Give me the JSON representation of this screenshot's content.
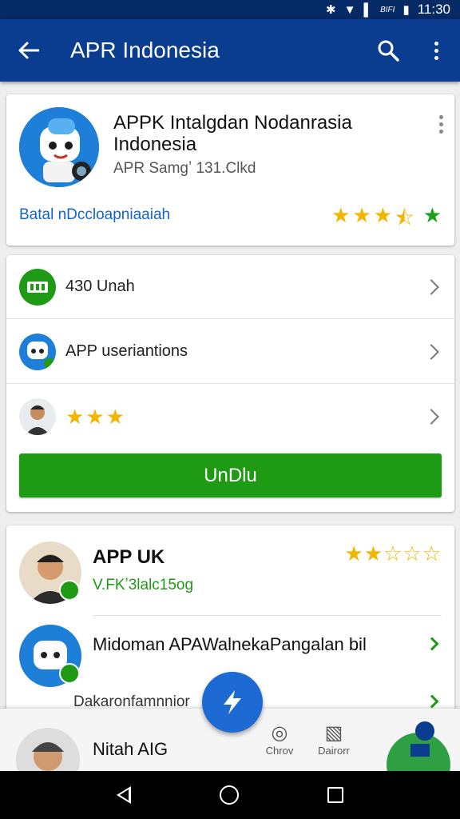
{
  "status_bar": {
    "time": "11:30",
    "carrier": "BIFI"
  },
  "app_bar": {
    "title": "APR Indonesia"
  },
  "app_info": {
    "name": "APPK Intalgdan Nodanrasia Indonesia",
    "meta": "APR Samgʼ 131.Clkd",
    "developer": "Batal nDccloapniaaiah",
    "rating_stars": 3.5
  },
  "details": {
    "rows": [
      {
        "label": "430 Unah"
      },
      {
        "label": "APP useriantions"
      },
      {
        "label": "",
        "stars": "★★★"
      }
    ],
    "install_label": "UnDlu"
  },
  "reviews": {
    "first": {
      "name": "APP UK",
      "subtitle": "V.FKʼ3lalc15og",
      "stars": "★★☆☆☆"
    },
    "second": {
      "text": "Midoman APAWalnekaPangalan bil"
    },
    "third": {
      "text": "Dakaronfamnnior"
    }
  },
  "bottom_panel": {
    "name": "Nitah AIG",
    "tabs": [
      {
        "label": "Chrov"
      },
      {
        "label": "Dairorr"
      }
    ]
  },
  "colors": {
    "primary": "#0a3d8f",
    "status_bar": "#062a66",
    "install_green": "#1e9a14",
    "star": "#f2b600",
    "fab": "#1d6ad4"
  }
}
